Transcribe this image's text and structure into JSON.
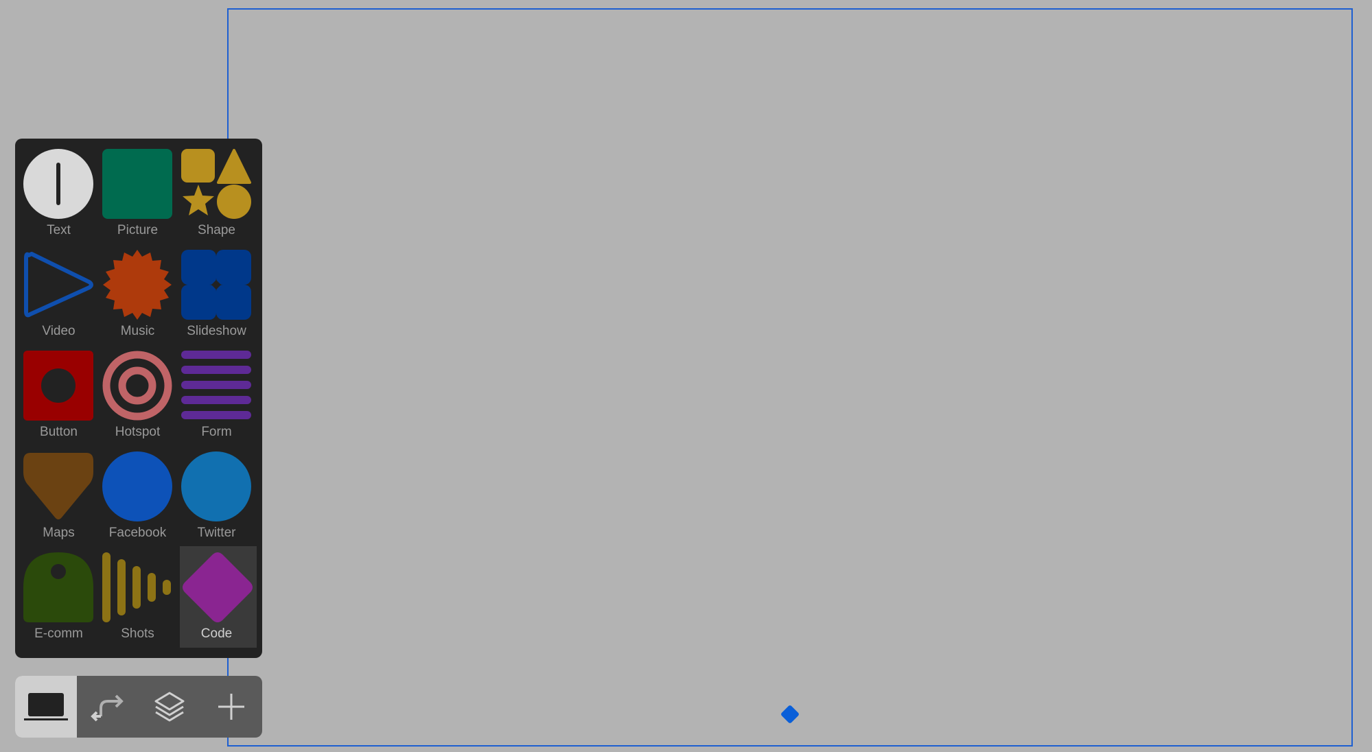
{
  "palette": {
    "items": [
      {
        "label": "Text",
        "icon": "text-cursor-icon",
        "color": "#d9d9d9"
      },
      {
        "label": "Picture",
        "icon": "picture-icon",
        "color": "#006b4f"
      },
      {
        "label": "Shape",
        "icon": "shapes-icon",
        "color": "#b8901f"
      },
      {
        "label": "Video",
        "icon": "play-icon",
        "color": "#0f4fae"
      },
      {
        "label": "Music",
        "icon": "burst-icon",
        "color": "#ae3a0c"
      },
      {
        "label": "Slideshow",
        "icon": "slideshow-icon",
        "color": "#00388a"
      },
      {
        "label": "Button",
        "icon": "button-icon",
        "color": "#990000"
      },
      {
        "label": "Hotspot",
        "icon": "target-icon",
        "color": "#c06467"
      },
      {
        "label": "Form",
        "icon": "form-lines-icon",
        "color": "#5e2a96"
      },
      {
        "label": "Maps",
        "icon": "map-pin-icon",
        "color": "#6b4212"
      },
      {
        "label": "Facebook",
        "icon": "facebook-icon",
        "color": "#0d52b8"
      },
      {
        "label": "Twitter",
        "icon": "twitter-icon",
        "color": "#1170b0"
      },
      {
        "label": "E-comm",
        "icon": "tag-icon",
        "color": "#2b4a0b"
      },
      {
        "label": "Shots",
        "icon": "audio-bars-icon",
        "color": "#8d7315"
      },
      {
        "label": "Code",
        "icon": "diamond-icon",
        "color": "#8a2591"
      }
    ],
    "selected": "Code"
  },
  "toolbar": {
    "buttons": [
      {
        "icon": "laptop-icon",
        "active": true
      },
      {
        "icon": "redirect-arrow-icon",
        "active": false
      },
      {
        "icon": "layers-icon",
        "active": false
      },
      {
        "icon": "plus-icon",
        "active": false
      }
    ]
  },
  "colors": {
    "canvas_border": "#1d5fd1",
    "panel_bg": "#222222",
    "workspace_bg": "#b3b3b3"
  }
}
